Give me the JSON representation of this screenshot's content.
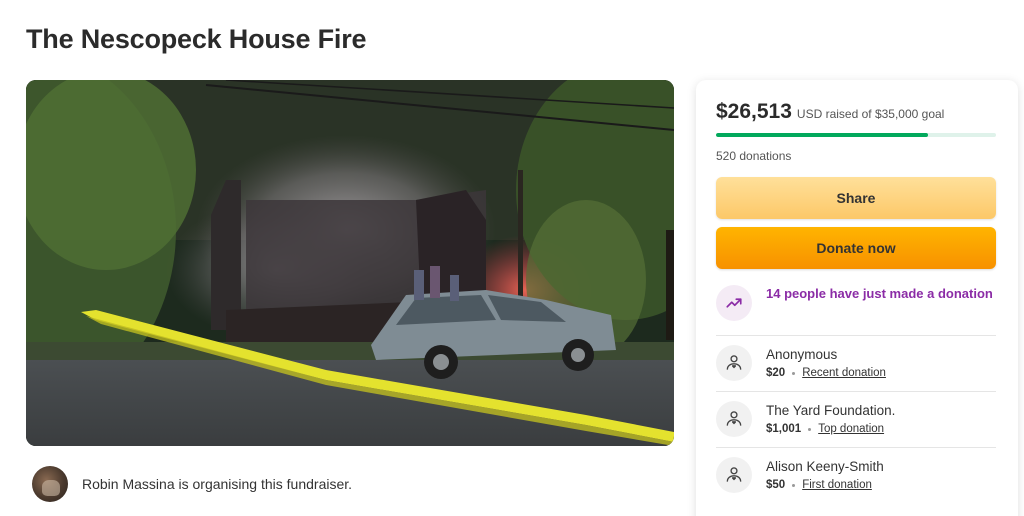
{
  "page": {
    "title": "The Nescopeck House Fire"
  },
  "organizer": {
    "text": "Robin Massina is organising this fundraiser."
  },
  "fundraiser": {
    "raised": "$26,513",
    "raised_suffix": "USD raised of $35,000 goal",
    "progress_fraction": 0.7575,
    "donations_count": "520 donations",
    "share_label": "Share",
    "donate_label": "Donate now",
    "trend_text": "14 people have just made a donation"
  },
  "donors": [
    {
      "name": "Anonymous",
      "amount": "$20",
      "tag": "Recent donation"
    },
    {
      "name": "The Yard Foundation.",
      "amount": "$1,001",
      "tag": "Top donation"
    },
    {
      "name": "Alison Keeny-Smith",
      "amount": "$50",
      "tag": "First donation"
    }
  ],
  "colors": {
    "progress": "#02a95c",
    "trend_text": "#8b2ca6",
    "donate_button": "#f79100",
    "share_button": "#fcc868"
  },
  "icons": {
    "trend": "trending-up-icon",
    "donor": "heart-hand-icon"
  }
}
